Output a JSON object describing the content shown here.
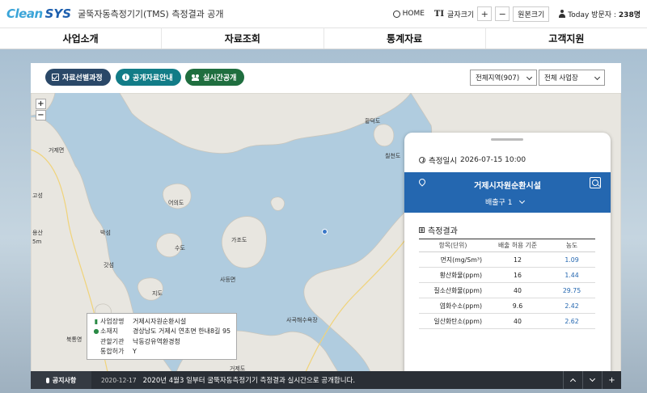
{
  "header": {
    "logo_clean": "Clean",
    "logo_sys": "SYS",
    "title": "굴뚝자동측정기기(TMS) 측정결과 공개",
    "home": "HOME",
    "font_size_label": "글자크기",
    "plus": "+",
    "minus": "−",
    "original_size": "원본크기",
    "visitor_label": "Today 방문자 :",
    "visitor_count": "238명"
  },
  "nav": [
    "사업소개",
    "자료조회",
    "통계자료",
    "고객지원"
  ],
  "toolbar": {
    "btn_data_selection": "자료선별과정",
    "btn_public_info": "공개자료안내",
    "btn_realtime": "실시간공개",
    "region_select": "전체지역(907)",
    "site_select": "전체 사업장"
  },
  "map": {
    "zoom_in": "+",
    "zoom_out": "−",
    "labels": [
      {
        "name": "거제면"
      },
      {
        "name": "어의도"
      },
      {
        "name": "가조도"
      },
      {
        "name": "수도"
      },
      {
        "name": "칠천도"
      },
      {
        "name": "황덕도"
      },
      {
        "name": "지도"
      },
      {
        "name": "사등면"
      },
      {
        "name": "사곡해수욕장"
      },
      {
        "name": "고성"
      },
      {
        "name": "박섬"
      },
      {
        "name": "갓섬"
      },
      {
        "name": "북통영"
      },
      {
        "name": "거제도"
      },
      {
        "name": "용산"
      },
      {
        "name": "5m"
      }
    ]
  },
  "popup": {
    "rows": [
      {
        "label": "사업장명",
        "value": "거제시자원순환시설"
      },
      {
        "label": "소재지",
        "value": "경상남도 거제시 연초면 한내8길 95"
      },
      {
        "label": "관할기관",
        "value": "낙동강유역환경청"
      },
      {
        "label": "통합허가",
        "value": "Y"
      }
    ]
  },
  "card": {
    "datetime_label": "측정일시",
    "datetime_value": "2026-07-15 10:00",
    "facility_name": "거제시자원순환시설",
    "outlet": "배출구 1",
    "results_title": "측정결과",
    "columns": [
      "항목(단위)",
      "배출 허용 기준",
      "농도"
    ],
    "rows": [
      {
        "item": "먼지(mg/Sm³)",
        "std": "12",
        "val": "1.09"
      },
      {
        "item": "황산화물(ppm)",
        "std": "16",
        "val": "1.44"
      },
      {
        "item": "질소산화물(ppm)",
        "std": "40",
        "val": "29.75"
      },
      {
        "item": "염화수소(ppm)",
        "std": "9.6",
        "val": "2.42"
      },
      {
        "item": "일산화탄소(ppm)",
        "std": "40",
        "val": "2.62"
      }
    ]
  },
  "notice": {
    "label": "공지사항",
    "date": "2020-12-17",
    "text": "2020년 4월3 일부터 굴뚝자동측정기기 측정결과 실시간으로 공개합니다.",
    "plus": "+"
  }
}
